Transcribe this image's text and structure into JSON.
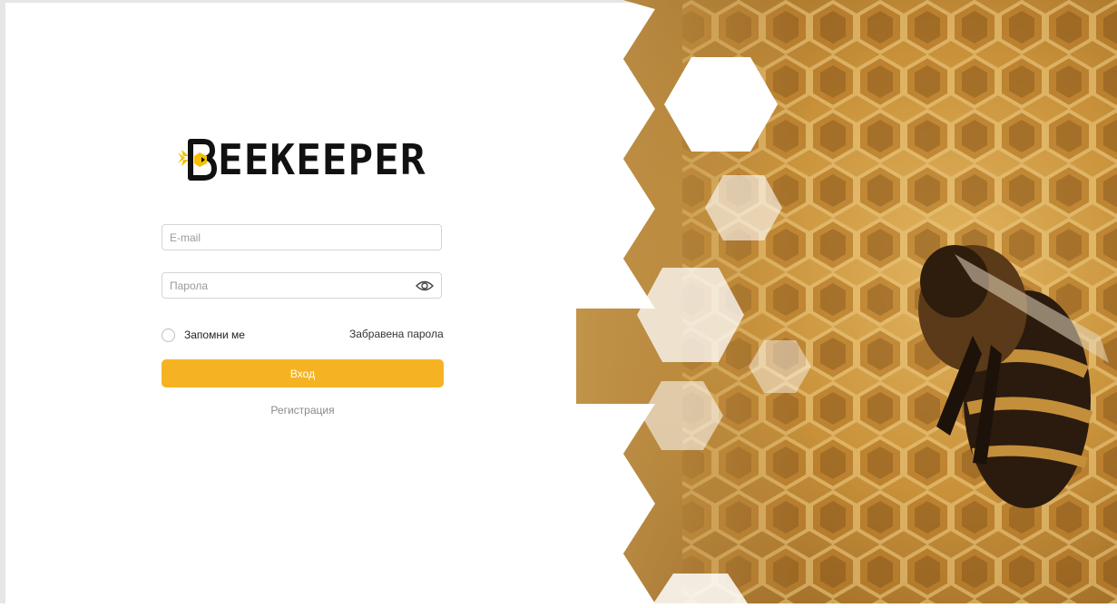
{
  "brand": {
    "name": "EEKEEPER"
  },
  "form": {
    "email_placeholder": "E-mail",
    "password_placeholder": "Парола",
    "remember_label": "Запомни ме",
    "forgot_label": "Забравена парола",
    "login_label": "Вход",
    "register_label": "Регистрация"
  },
  "colors": {
    "accent": "#f5b324",
    "text": "#222222",
    "muted": "#8a8a8a",
    "border": "#d4d4d4"
  },
  "icons": {
    "logo": "bee-logo-icon",
    "password_toggle": "eye-icon",
    "remember": "radio-icon"
  }
}
